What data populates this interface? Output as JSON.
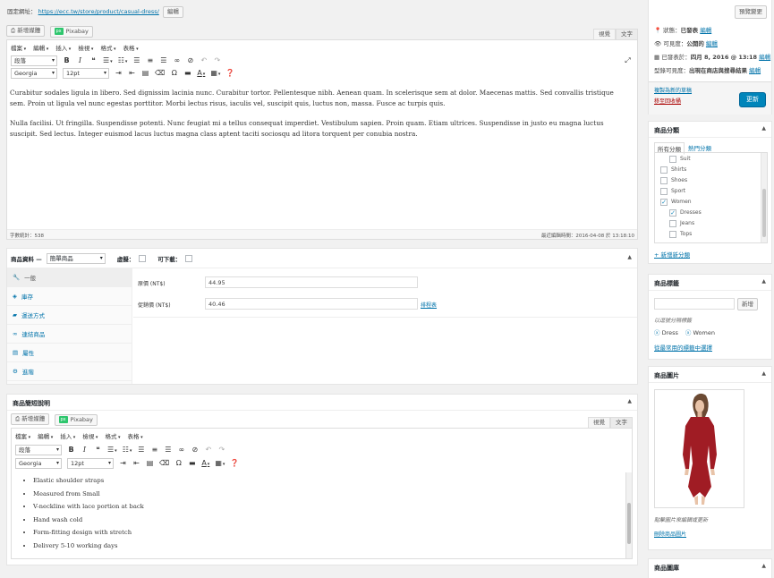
{
  "permalink": {
    "label": "固定網址：",
    "url": "https://ecc.tw/store/product/casual-dress/",
    "edit": "編輯"
  },
  "editor": {
    "add_media": "新增媒體",
    "pixabay": "Pixabay",
    "tab_visual": "視覺",
    "tab_text": "文字",
    "menus": [
      "檔案",
      "編輯",
      "插入",
      "檢視",
      "格式",
      "表格"
    ],
    "format_select": "段落",
    "font_select": "Georgia",
    "size_select": "12pt",
    "paragraphs": [
      "Curabitur sodales ligula in libero. Sed dignissim lacinia nunc. Curabitur tortor. Pellentesque nibh. Aenean quam. In scelerisque sem at dolor. Maecenas mattis. Sed convallis tristique sem. Proin ut ligula vel nunc egestas porttitor. Morbi lectus risus, iaculis vel, suscipit quis, luctus non, massa. Fusce ac turpis quis.",
      "Nulla facilisi. Ut fringilla. Suspendisse potenti. Nunc feugiat mi a tellus consequat imperdiet. Vestibulum sapien. Proin quam. Etiam ultrices. Suspendisse in justo eu magna luctus suscipit. Sed lectus. Integer euismod lacus luctus magna class aptent taciti sociosqu ad litora torquent per conubia nostra."
    ],
    "word_count": "字數統計：538",
    "last_edited": "最近編輯時間：2016-04-08 於 13:18:10"
  },
  "product_data": {
    "title": "商品資料 —",
    "type_select": "簡單商品",
    "virtual": "虛擬：",
    "downloadable": "可下載：",
    "tabs": [
      "一般",
      "庫存",
      "運送方式",
      "連結商品",
      "屬性",
      "進階"
    ],
    "regular_price_label": "原價 (NT$)",
    "regular_price": "44.95",
    "sale_price_label": "促銷價 (NT$)",
    "sale_price": "40.46",
    "schedule": "排程表"
  },
  "short_desc": {
    "title": "商品簡短說明",
    "add_media": "新增媒體",
    "pixabay": "Pixabay",
    "tab_visual": "視覺",
    "tab_text": "文字",
    "menus": [
      "檔案",
      "編輯",
      "插入",
      "檢視",
      "格式",
      "表格"
    ],
    "format_select": "段落",
    "font_select": "Georgia",
    "size_select": "12pt",
    "items": [
      "Elastic shoulder straps",
      "Measured from Small",
      "V-neckline with lace portion at back",
      "Hand wash cold",
      "Form-fitting design with stretch",
      "Delivery 5-10 working days"
    ]
  },
  "publish": {
    "preview": "預覽變更",
    "status_label": "狀態：",
    "status": "已發表",
    "status_edit": "編輯",
    "visibility_label": "可見度：",
    "visibility": "公開的",
    "visibility_edit": "編輯",
    "published_label": "已發表於：",
    "published": "四月 8, 2016 @ 13:18",
    "published_edit": "編輯",
    "catalog_label": "型錄可見度：",
    "catalog": "出現在商店與搜尋結果",
    "catalog_edit": "編輯",
    "copy": "複製為新的草稿",
    "trash": "移至回收桶",
    "update": "更新"
  },
  "categories": {
    "title": "商品分類",
    "tab_all": "所有分類",
    "tab_popular": "熱門分類",
    "items": [
      {
        "name": "Suit",
        "checked": false,
        "indent": 1
      },
      {
        "name": "Shirts",
        "checked": false,
        "indent": 0
      },
      {
        "name": "Shoes",
        "checked": false,
        "indent": 0
      },
      {
        "name": "Sport",
        "checked": false,
        "indent": 0
      },
      {
        "name": "Women",
        "checked": true,
        "indent": 0
      },
      {
        "name": "Dresses",
        "checked": true,
        "indent": 1
      },
      {
        "name": "Jeans",
        "checked": false,
        "indent": 1
      },
      {
        "name": "Tops",
        "checked": false,
        "indent": 1
      }
    ],
    "add_new": "+ 新增新分類"
  },
  "tags": {
    "title": "商品標籤",
    "add": "新增",
    "hint": "以逗號分隔標籤",
    "tags": [
      "Dress",
      "Women"
    ],
    "choose": "從最常用的標籤中選擇"
  },
  "image": {
    "title": "商品圖片",
    "hint": "點擊圖片來編輯或更新",
    "remove": "刪除商品圖片"
  },
  "gallery": {
    "title": "商品圖庫"
  },
  "colors": {
    "accent": "#0085ba",
    "link": "#0073aa",
    "trash": "#a00",
    "dress": "#a01c24"
  }
}
